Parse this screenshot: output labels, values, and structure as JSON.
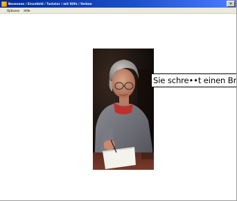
{
  "window": {
    "title": "Benennen / Einzelbild / Tastatur / mit Hilfe / Verben",
    "controls": {
      "close_label": "×"
    }
  },
  "menubar": {
    "items": [
      {
        "label": "Optionen"
      },
      {
        "label": "Hilfe"
      }
    ]
  },
  "content": {
    "caption": "Sie schre••t einen Brief."
  },
  "colors": {
    "titlebar_start": "#002a93",
    "titlebar_end": "#4b7dff",
    "menubar_bg": "#ece9d8",
    "client_bg": "#ffffff"
  },
  "icons": {
    "app": "app-icon",
    "close": "close-icon"
  }
}
